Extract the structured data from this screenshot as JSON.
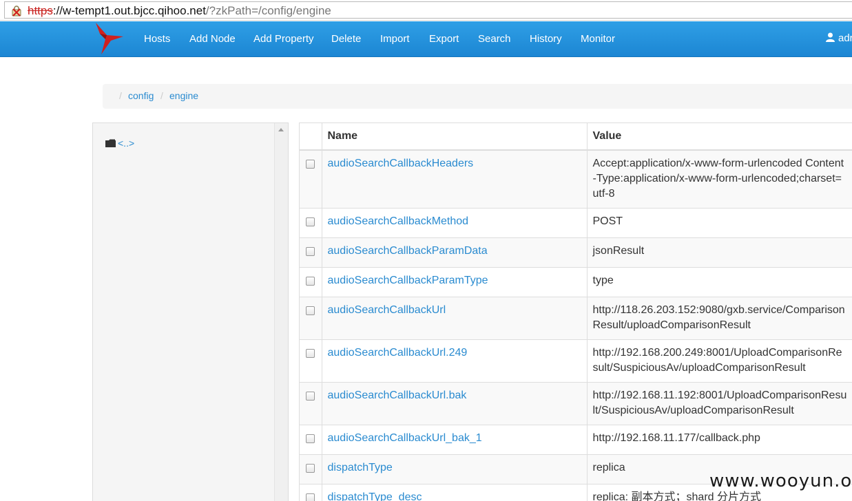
{
  "address_bar": {
    "protocol": "https",
    "host": "://w-tempt1.out.bjcc.qihoo.net",
    "path": "/?zkPath=/config/engine"
  },
  "navbar": {
    "items": [
      "Hosts",
      "Add Node",
      "Add Property",
      "Delete",
      "Import",
      "Export",
      "Search",
      "History",
      "Monitor"
    ],
    "user": "adr",
    "brand_color": "#c9211e",
    "bar_color": "#2490dc"
  },
  "breadcrumb": {
    "items": [
      "config",
      "engine"
    ]
  },
  "tree": {
    "items": [
      {
        "label": "<..>",
        "icon": "folder-icon"
      }
    ]
  },
  "table": {
    "headers": {
      "name": "Name",
      "value": "Value"
    },
    "rows": [
      {
        "name": "audioSearchCallbackHeaders",
        "value": "Accept:application/x-www-form-urlencoded Content-Type:application/x-www-form-urlencoded;charset=utf-8"
      },
      {
        "name": "audioSearchCallbackMethod",
        "value": "POST"
      },
      {
        "name": "audioSearchCallbackParamData",
        "value": "jsonResult"
      },
      {
        "name": "audioSearchCallbackParamType",
        "value": "type"
      },
      {
        "name": "audioSearchCallbackUrl",
        "value": "http://118.26.203.152:9080/gxb.service/ComparisonResult/uploadComparisonResult"
      },
      {
        "name": "audioSearchCallbackUrl.249",
        "value": "http://192.168.200.249:8001/UploadComparisonResult/SuspiciousAv/uploadComparisonResult"
      },
      {
        "name": "audioSearchCallbackUrl.bak",
        "value": "http://192.168.11.192:8001/UploadComparisonResult/SuspiciousAv/uploadComparisonResult"
      },
      {
        "name": "audioSearchCallbackUrl_bak_1",
        "value": "http://192.168.11.177/callback.php"
      },
      {
        "name": "dispatchType",
        "value": "replica"
      },
      {
        "name": "dispatchType_desc",
        "value": "replica: 副本方式；shard 分片方式"
      }
    ]
  },
  "watermark": "www.wooyun.org"
}
